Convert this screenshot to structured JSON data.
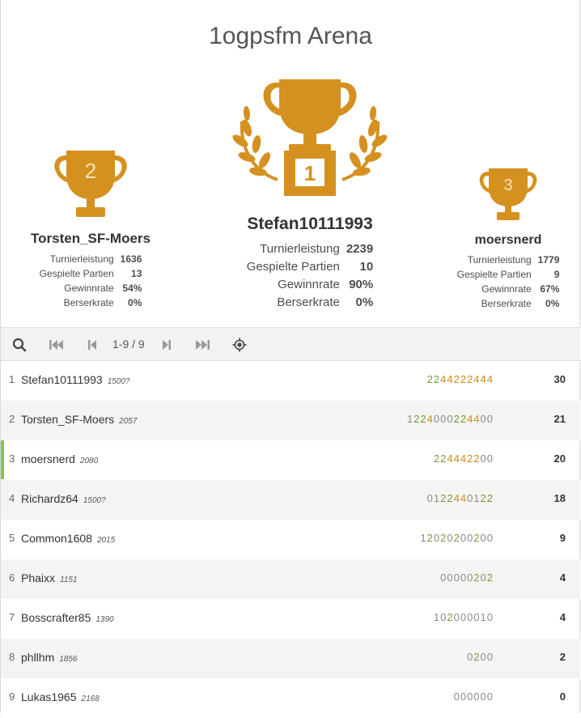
{
  "tournament": {
    "title": "1ogpsfm Arena"
  },
  "colors": {
    "trophy": "#d59120",
    "streak_green": "#7a9a3a",
    "double_orange": "#cf8b1f",
    "me_bar": "#8bc34a"
  },
  "podium": {
    "first": {
      "rank_label": "1",
      "name": "Stefan10111993",
      "stats": [
        {
          "label": "Turnierleistung",
          "value": "2239"
        },
        {
          "label": "Gespielte Partien",
          "value": "10"
        },
        {
          "label": "Gewinnrate",
          "value": "90%"
        },
        {
          "label": "Berserkrate",
          "value": "0%"
        }
      ]
    },
    "second": {
      "rank_label": "2",
      "name": "Torsten_SF-Moers",
      "stats": [
        {
          "label": "Turnierleistung",
          "value": "1636"
        },
        {
          "label": "Gespielte Partien",
          "value": "13"
        },
        {
          "label": "Gewinnrate",
          "value": "54%"
        },
        {
          "label": "Berserkrate",
          "value": "0%"
        }
      ]
    },
    "third": {
      "rank_label": "3",
      "name": "moersnerd",
      "stats": [
        {
          "label": "Turnierleistung",
          "value": "1779"
        },
        {
          "label": "Gespielte Partien",
          "value": "9"
        },
        {
          "label": "Gewinnrate",
          "value": "67%"
        },
        {
          "label": "Berserkrate",
          "value": "0%"
        }
      ]
    }
  },
  "pager": {
    "page_info": "1-9 / 9",
    "icons": [
      "search-icon",
      "first-page-icon",
      "prev-page-icon",
      "next-page-icon",
      "last-page-icon",
      "locate-me-icon"
    ]
  },
  "standings": [
    {
      "rank": "1",
      "name": "Stefan10111993",
      "rating": "1500?",
      "sheet": "2244222444",
      "score": "30"
    },
    {
      "rank": "2",
      "name": "Torsten_SF-Moers",
      "rating": "2057",
      "sheet": "1224000224400",
      "score": "21"
    },
    {
      "rank": "3",
      "name": "moersnerd",
      "rating": "2080",
      "sheet": "224442200",
      "score": "20"
    },
    {
      "rank": "4",
      "name": "Richardz64",
      "rating": "1500?",
      "sheet": "0122440122",
      "score": "18"
    },
    {
      "rank": "5",
      "name": "Common1608",
      "rating": "2015",
      "sheet": "12020200200",
      "score": "9"
    },
    {
      "rank": "6",
      "name": "Phaixx",
      "rating": "1151",
      "sheet": "00000202",
      "score": "4"
    },
    {
      "rank": "7",
      "name": "Bosscrafter85",
      "rating": "1390",
      "sheet": "102000010",
      "score": "4"
    },
    {
      "rank": "8",
      "name": "phllhm",
      "rating": "1856",
      "sheet": "0200",
      "score": "2"
    },
    {
      "rank": "9",
      "name": "Lukas1965",
      "rating": "2168",
      "sheet": "000000",
      "score": "0"
    }
  ]
}
